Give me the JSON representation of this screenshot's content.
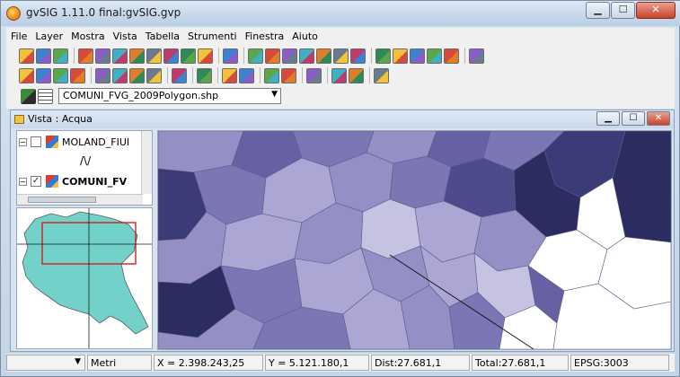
{
  "window": {
    "title": "gvSIG 1.11.0 final:gvSIG.gvp",
    "minimize_label": "▁",
    "maximize_label": "☐",
    "close_label": "✕"
  },
  "menubar": {
    "items": [
      "File",
      "Layer",
      "Mostra",
      "Vista",
      "Tabella",
      "Strumenti",
      "Finestra",
      "Aiuto"
    ]
  },
  "toolbar": {
    "row1_icons": [
      "new-project-icon",
      "open-project-icon",
      "save-project-icon",
      "sep",
      "layer-stack-icon",
      "edit-layer-icon",
      "symbology-icon",
      "vector-tools-icon",
      "raster-tools-icon",
      "export-icon",
      "color-picker-icon",
      "target-icon",
      "sep",
      "cloud-add-icon",
      "sep",
      "zoom-in-tool-icon",
      "zoom-out-tool-icon",
      "zoom-full-icon",
      "zoom-layer-icon",
      "zoom-select-icon",
      "zoom-prev-icon",
      "pan-icon",
      "sep",
      "info-xy-icon",
      "info-icon",
      "measure-distance-icon",
      "measure-area-icon",
      "geo-process-icon",
      "sep",
      "speech-icon"
    ],
    "row2_icons": [
      "select-point-icon",
      "select-rect-icon",
      "select-poly-icon",
      "select-invert-icon",
      "sep",
      "grey-box-icon",
      "select-by-line-icon",
      "select-circle-icon",
      "select-buffer-icon",
      "sep",
      "filter-icon",
      "sep",
      "table-select-icon",
      "sep",
      "hammer-icon",
      "grey-shape-icon",
      "sep",
      "find-icon",
      "zoom-feature-icon",
      "sep",
      "pencil-icon",
      "sep",
      "frame-icon",
      "locator-icon",
      "sep",
      "export-map-icon"
    ],
    "layer_combo_value": "COMUNI_FVG_2009Polygon.shp"
  },
  "view": {
    "title": "Vista : Acqua",
    "toc_layers": [
      {
        "name": "MOLAND_FIUI",
        "checked": false,
        "bold": false
      },
      {
        "name": "COMUNI_FV",
        "checked": true,
        "bold": true
      }
    ],
    "legend_symbol": "/\\/",
    "map_colors": [
      "#2b2c5f",
      "#3b3b78",
      "#4d4b8c",
      "#6561a3",
      "#7b76b4",
      "#948fc4",
      "#aba6d3",
      "#c6c2e2"
    ],
    "locator_fill": "#72d1c9"
  },
  "statusbar": {
    "scale": "",
    "units": "Metri",
    "x_coord": "X = 2.398.243,25",
    "y_coord": "Y = 5.121.180,1",
    "dist": "Dist:27.681,1",
    "total": "Total:27.681,1",
    "epsg": "EPSG:3003"
  }
}
